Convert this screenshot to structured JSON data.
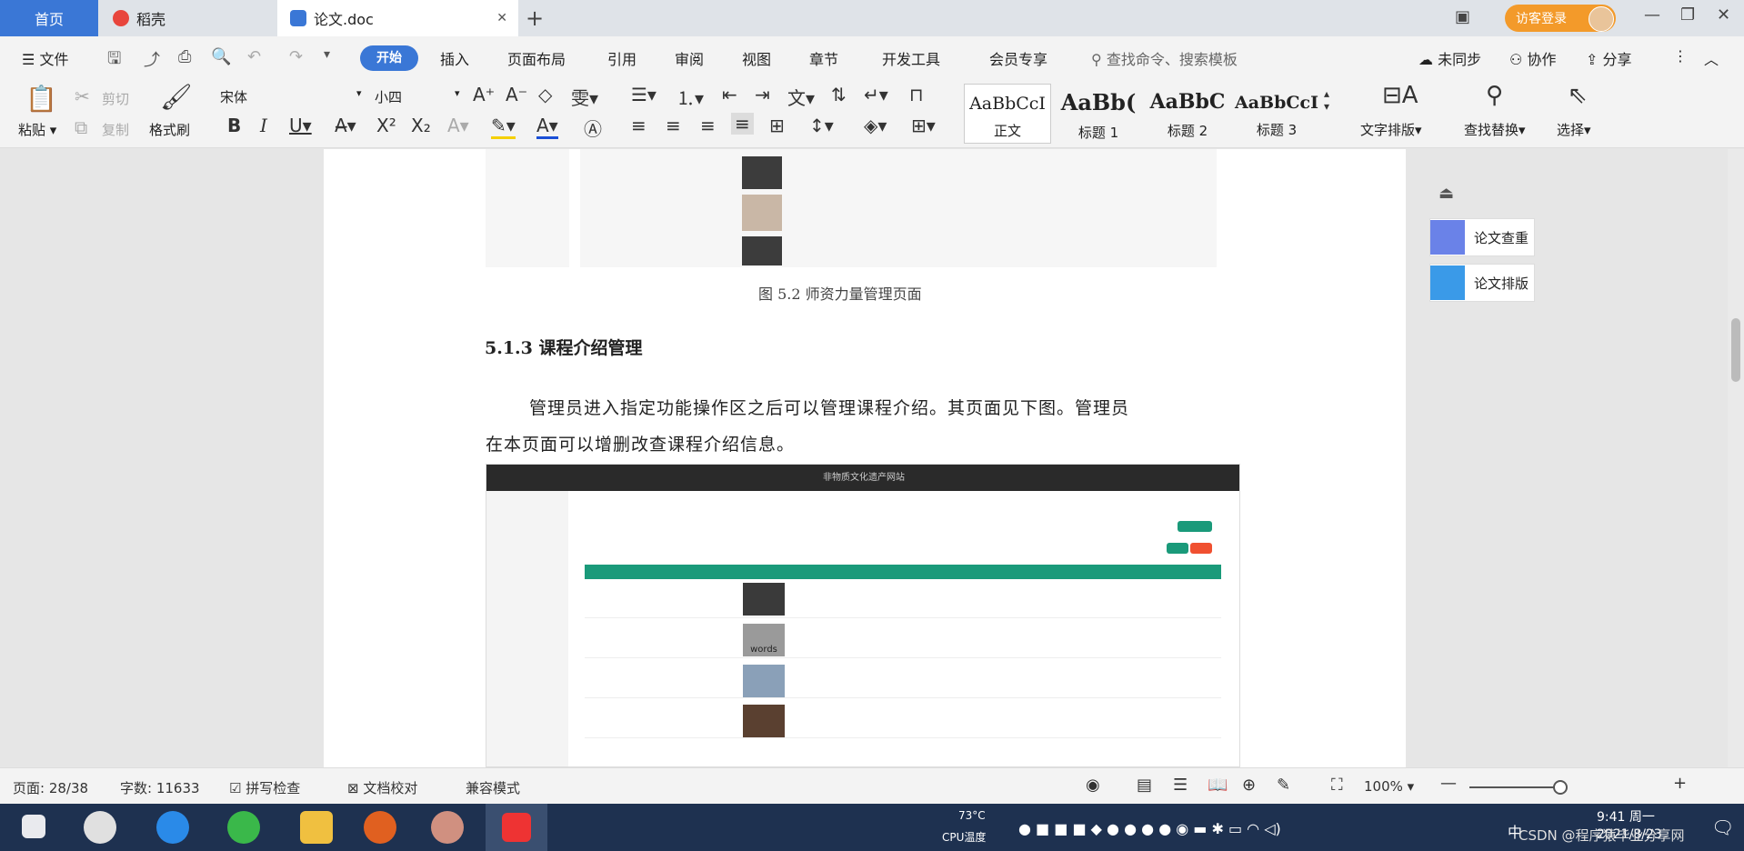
{
  "tabs": [
    {
      "label": "首页"
    },
    {
      "label": "稻壳"
    },
    {
      "label": "论文.doc"
    }
  ],
  "header": {
    "visitor_login": "访客登录"
  },
  "menu": {
    "file": "文件",
    "items": [
      "开始",
      "插入",
      "页面布局",
      "引用",
      "审阅",
      "视图",
      "章节",
      "开发工具",
      "会员专享"
    ],
    "search_placeholder": "查找命令、搜索模板",
    "sync": "未同步",
    "collab": "协作",
    "share": "分享"
  },
  "ribbon": {
    "paste": "粘贴",
    "cut": "剪切",
    "copy": "复制",
    "format_painter": "格式刷",
    "font": "宋体",
    "size": "小四",
    "styles": [
      {
        "sample": "AaBbCcI",
        "name": "正文"
      },
      {
        "sample": "AaBb(",
        "name": "标题 1"
      },
      {
        "sample": "AaBbC",
        "name": "标题 2"
      },
      {
        "sample": "AaBbCcI",
        "name": "标题 3"
      }
    ],
    "text_layout": "文字排版",
    "find_replace": "查找替换",
    "select": "选择"
  },
  "document": {
    "figure_caption": "图 5.2  师资力量管理页面",
    "section_heading": "5.1.3  课程介绍管理",
    "para_line1": "管理员进入指定功能操作区之后可以管理课程介绍。其页面见下图。管理员",
    "para_line2": "在本页面可以增删改查课程介绍信息。",
    "embedded_title": "非物质文化遗产网站",
    "embedded_photo_text": "words"
  },
  "side_panel": {
    "check": "论文查重",
    "layout": "论文排版"
  },
  "status": {
    "page": "页面: 28/38",
    "words": "字数: 11633",
    "spell": "拼写检查",
    "proof": "文档校对",
    "compat": "兼容模式",
    "zoom": "100%"
  },
  "taskbar": {
    "cpu_temp": "73°C",
    "cpu_label": "CPU温度",
    "time": "9:41 周一",
    "date": "2021/8/23",
    "ime": "中",
    "watermark": "CSDN @程序猿毕业分享网"
  },
  "colors": {
    "accent": "#3a77d6",
    "teal": "#1a9a7a",
    "orange": "#f39a2a"
  }
}
